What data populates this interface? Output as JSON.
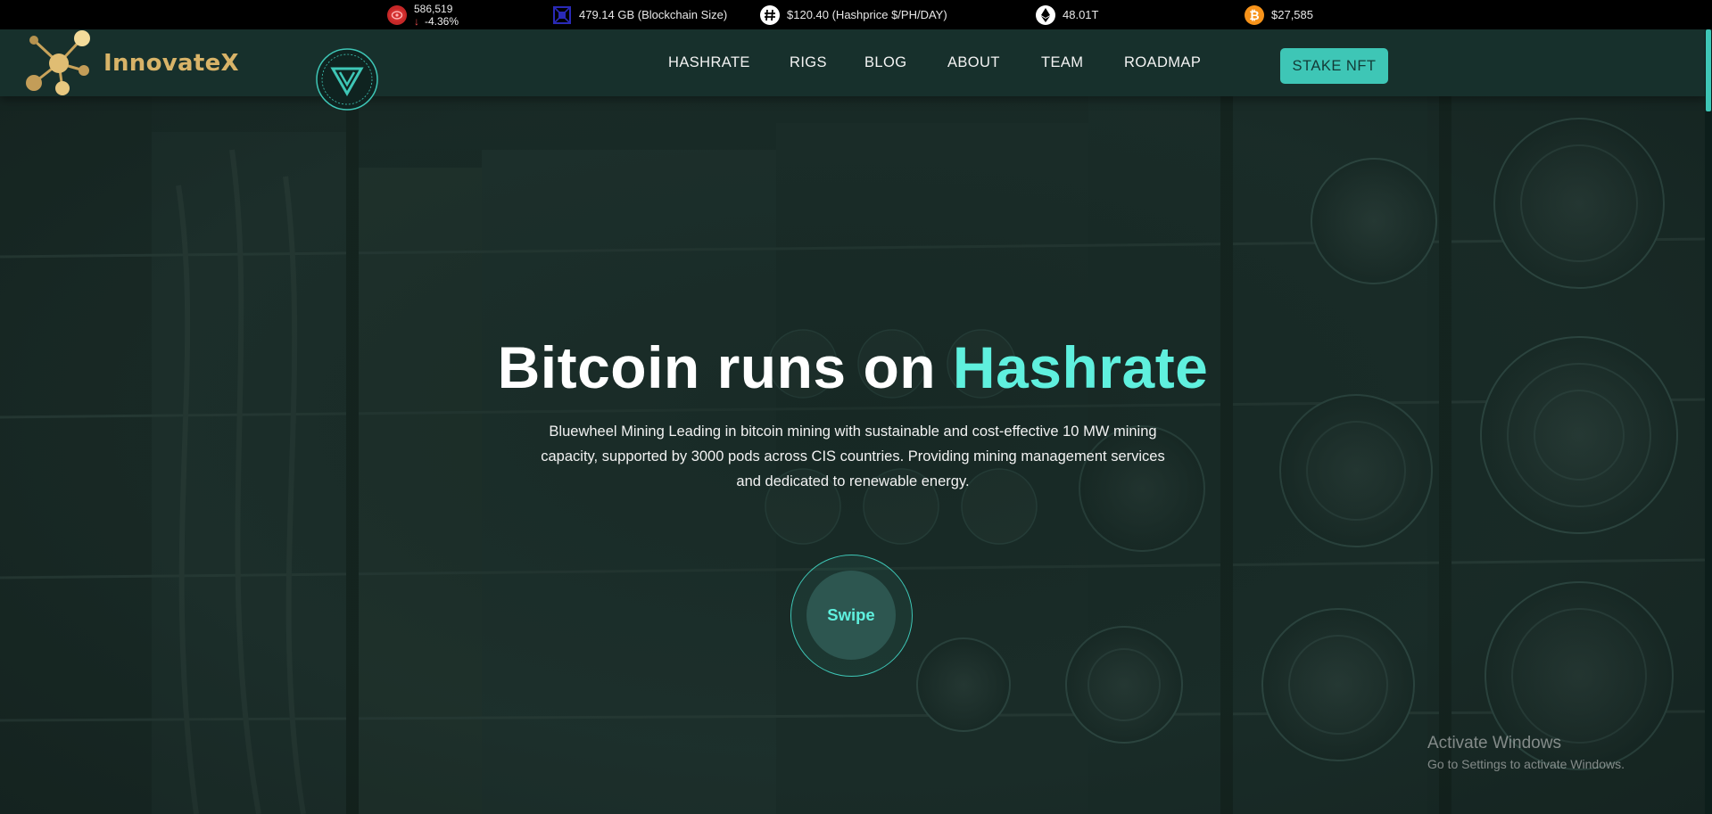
{
  "ticker": [
    {
      "icon": "red-coin-icon",
      "value": "586,519",
      "change": "-4.36%",
      "direction": "down",
      "color": "#e23b3b"
    },
    {
      "icon": "blockchain-cube-icon",
      "value": "479.14 GB (Blockchain Size)",
      "color": "#2a2ab8"
    },
    {
      "icon": "hash-icon",
      "value": "$120.40 (Hashprice $/PH/DAY)",
      "color": "#ffffff"
    },
    {
      "icon": "ethereum-icon",
      "value": "48.01T",
      "color": "#ffffff"
    },
    {
      "icon": "bitcoin-icon",
      "value": "$27,585",
      "color": "#f7931a"
    }
  ],
  "header": {
    "brand": "InnovateX",
    "brand_color": "#d8b368",
    "nav": [
      "HASHRATE",
      "RIGS",
      "BLOG",
      "ABOUT",
      "TEAM",
      "ROADMAP"
    ],
    "cta": "STAKE NFT",
    "accent": "#3ec6b6"
  },
  "hero": {
    "title_main": "Bitcoin runs on ",
    "title_accent": "Hashrate",
    "description": "Bluewheel Mining Leading in bitcoin mining with sustainable and cost-effective 10 MW mining capacity, supported by 3000 pods across CIS countries. Providing mining management services and dedicated to renewable energy.",
    "swipe": "Swipe"
  },
  "watermark": {
    "title": "Activate Windows",
    "subtitle": "Go to Settings to activate Windows."
  }
}
